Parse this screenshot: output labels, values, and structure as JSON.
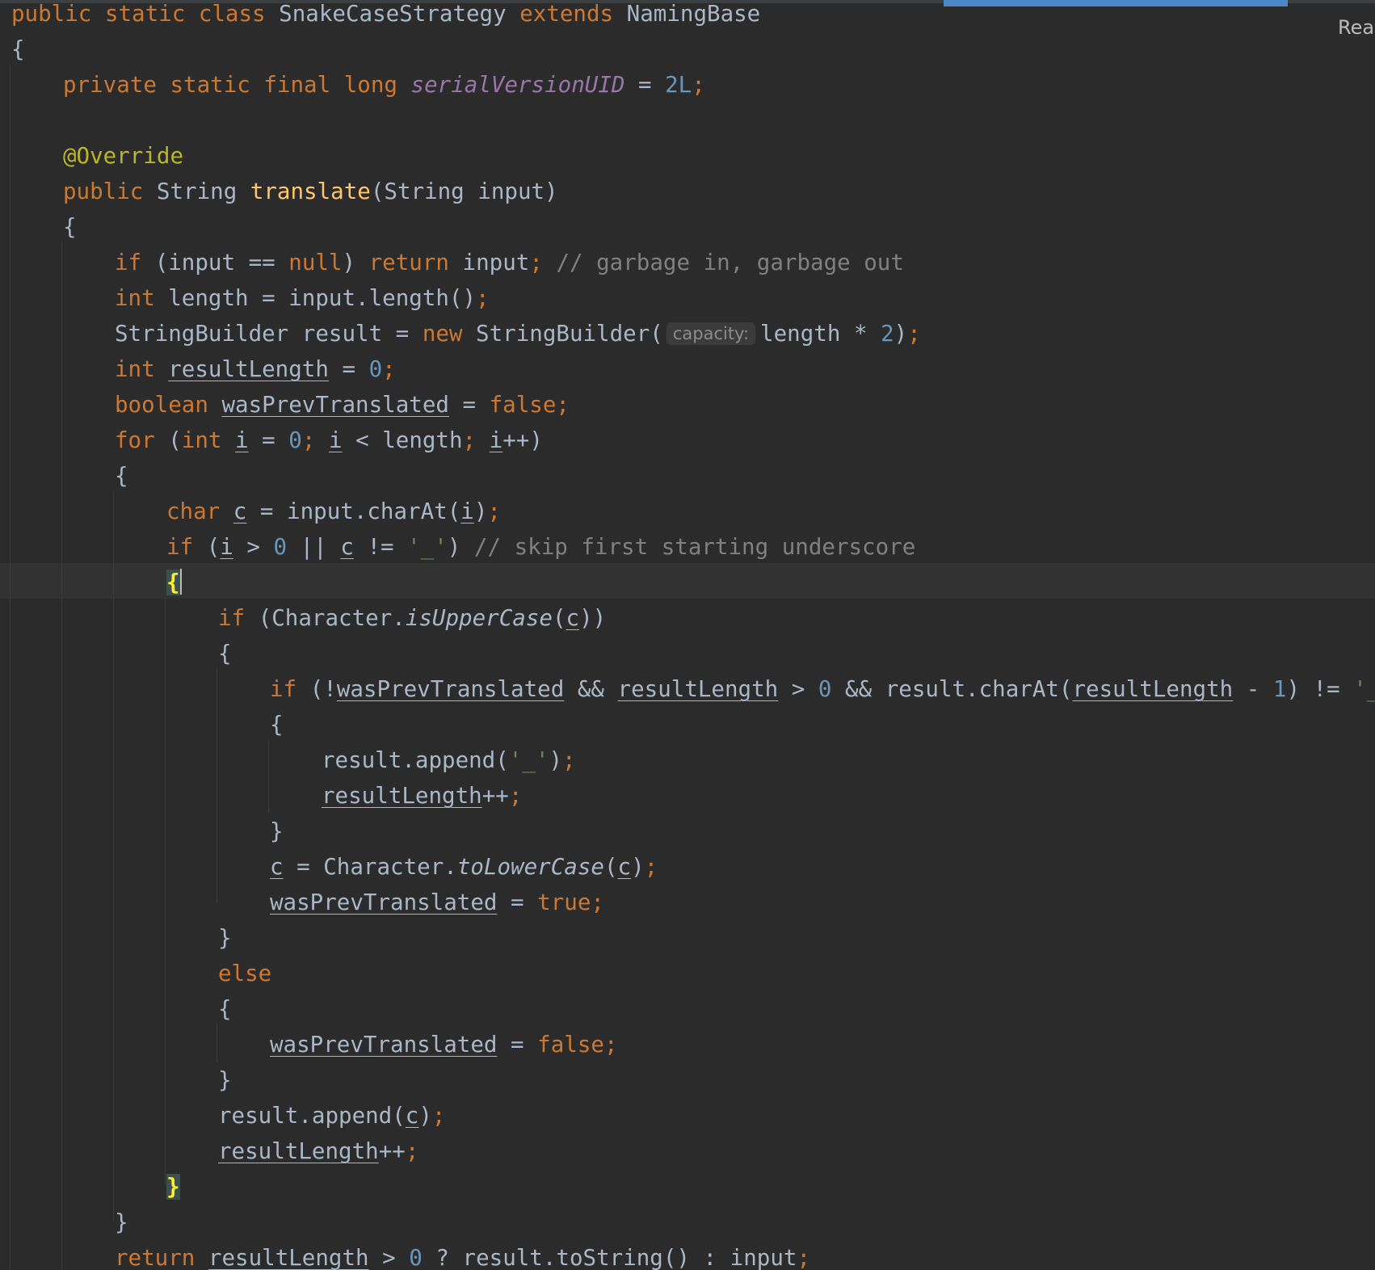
{
  "reader_mode": {
    "label": "Reac"
  },
  "code": {
    "l1": {
      "a": "public",
      "b": "static",
      "c": "class",
      "d": "SnakeCaseStrategy",
      "e": "extends",
      "f": "NamingBase"
    },
    "l2": {
      "a": "{"
    },
    "l3": {
      "a": "private",
      "b": "static",
      "c": "final",
      "d": "long",
      "e": "serialVersionUID",
      "f": "=",
      "g": "2L",
      "h": ";"
    },
    "l5": {
      "a": "@Override"
    },
    "l6": {
      "a": "public",
      "b": "String",
      "c": "translate",
      "d": "(String input)"
    },
    "l7": {
      "a": "{"
    },
    "l8": {
      "a": "if",
      "b": "(input ==",
      "c": "null",
      "d": ")",
      "e": "return",
      "f": "input",
      "g": ";",
      "h": "// garbage in, garbage out"
    },
    "l9": {
      "a": "int",
      "b": "length = input.length()",
      "c": ";"
    },
    "l10": {
      "a": "StringBuilder result =",
      "b": "new",
      "c": "StringBuilder(",
      "hint": "capacity:",
      "d": "length *",
      "e": "2",
      "f": ")",
      "g": ";"
    },
    "l11": {
      "a": "int",
      "b": "resultLength",
      "c": "=",
      "d": "0",
      "e": ";"
    },
    "l12": {
      "a": "boolean",
      "b": "wasPrevTranslated",
      "c": "=",
      "d": "false",
      "e": ";"
    },
    "l13": {
      "a": "for",
      "b": "(",
      "c": "int",
      "d": "i",
      "e": "=",
      "f": "0",
      "g": ";",
      "h": "i",
      "i": "< length",
      "j": ";",
      "k": "i",
      "l": "++)"
    },
    "l14": {
      "a": "{"
    },
    "l15": {
      "a": "char",
      "b": "c",
      "c": "= input.charAt(",
      "d": "i",
      "e": ")",
      "f": ";"
    },
    "l16": {
      "a": "if",
      "b": "(",
      "c": "i",
      "d": ">",
      "e": "0",
      "f": "||",
      "g": "c",
      "h": "!=",
      "i": "'_'",
      "j": ")",
      "k": "// skip first starting underscore"
    },
    "l17": {
      "a": "{"
    },
    "l18": {
      "a": "if",
      "b": "(Character.",
      "c": "isUpperCase",
      "d": "(",
      "e": "c",
      "f": "))"
    },
    "l19": {
      "a": "{"
    },
    "l20": {
      "a": "if",
      "b": "(!",
      "c": "wasPrevTranslated",
      "d": "&&",
      "e": "resultLength",
      "f": ">",
      "g": "0",
      "h": "&& result.charAt(",
      "i": "resultLength",
      "j": "-",
      "k": "1",
      "l": ") !=",
      "m": "'_'",
      "n": ")"
    },
    "l21": {
      "a": "{"
    },
    "l22": {
      "a": "result.append(",
      "b": "'_'",
      "c": ")",
      "d": ";"
    },
    "l23": {
      "a": "resultLength",
      "b": "++",
      "c": ";"
    },
    "l24": {
      "a": "}"
    },
    "l25": {
      "a": "c",
      "b": "= Character.",
      "c": "toLowerCase",
      "d": "(",
      "e": "c",
      "f": ")",
      "g": ";"
    },
    "l26": {
      "a": "wasPrevTranslated",
      "b": "=",
      "c": "true",
      "d": ";"
    },
    "l27": {
      "a": "}"
    },
    "l28": {
      "a": "else"
    },
    "l29": {
      "a": "{"
    },
    "l30": {
      "a": "wasPrevTranslated",
      "b": "=",
      "c": "false",
      "d": ";"
    },
    "l31": {
      "a": "}"
    },
    "l32": {
      "a": "result.append(",
      "b": "c",
      "c": ")",
      "d": ";"
    },
    "l33": {
      "a": "resultLength",
      "b": "++",
      "c": ";"
    },
    "l34": {
      "a": "}"
    },
    "l35": {
      "a": "}"
    },
    "l36": {
      "a": "return",
      "b": "resultLength",
      "c": ">",
      "d": "0",
      "e": "? result.toString() : input",
      "f": ";"
    }
  }
}
